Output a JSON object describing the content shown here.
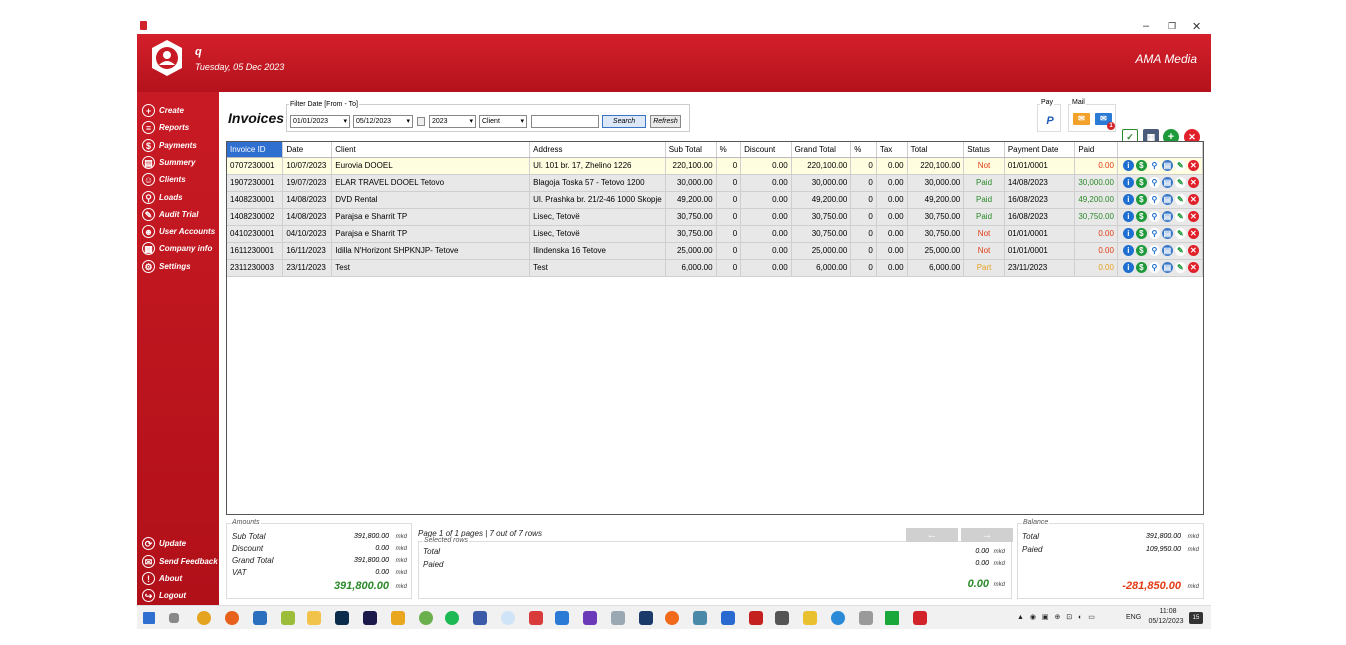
{
  "window": {
    "minimize": "–",
    "maximize": "❐",
    "close": "✕"
  },
  "header": {
    "user_name": "q",
    "date": "Tuesday, 05 Dec 2023",
    "company": "AMA Media"
  },
  "sidebar": {
    "items": [
      {
        "label": "Create",
        "icon": "plus-circle-icon"
      },
      {
        "label": "Reports",
        "icon": "reports-icon"
      },
      {
        "label": "Payments",
        "icon": "payments-icon"
      },
      {
        "label": "Summery",
        "icon": "summary-icon"
      },
      {
        "label": "Clients",
        "icon": "clients-icon"
      },
      {
        "label": "Loads",
        "icon": "loads-icon"
      },
      {
        "label": "Audit Trial",
        "icon": "audit-icon"
      },
      {
        "label": "User Accounts",
        "icon": "user-accounts-icon"
      },
      {
        "label": "Company info",
        "icon": "company-icon"
      },
      {
        "label": "Settings",
        "icon": "gear-icon"
      }
    ],
    "bottom_items": [
      {
        "label": "Update",
        "icon": "update-icon"
      },
      {
        "label": "Send Feedback",
        "icon": "feedback-icon"
      },
      {
        "label": "About",
        "icon": "info-icon"
      },
      {
        "label": "Logout",
        "icon": "logout-icon"
      }
    ]
  },
  "page": {
    "title": "Invoices"
  },
  "filter": {
    "legend": "Filter Date [From - To]",
    "date_from": "01/01/2023",
    "date_to": "05/12/2023",
    "year": "2023",
    "client": "Client",
    "search_value": "",
    "search_label": "Search",
    "refresh_label": "Refresh"
  },
  "toolbar": {
    "pay_label": "Pay",
    "mail_label": "Mail",
    "mail_badge": "1"
  },
  "grid": {
    "columns": [
      "Invoice ID",
      "Date",
      "Client",
      "Address",
      "Sub Total",
      "%",
      "Discount",
      "Grand Total",
      "%",
      "Tax",
      "Total",
      "Status",
      "Payment Date",
      "Paid"
    ],
    "rows": [
      [
        "0707230001",
        "10/07/2023",
        "Eurovia DOOEL",
        "Ul. 101 br. 17, Zhelino 1226",
        "220,100.00",
        "0",
        "0.00",
        "220,100.00",
        "0",
        "0.00",
        "220,100.00",
        "Not",
        "01/01/0001",
        "0.00"
      ],
      [
        "1907230001",
        "19/07/2023",
        "ELAR TRAVEL DOOEL Tetovo",
        "Blagoja Toska 57 - Tetovo 1200",
        "30,000.00",
        "0",
        "0.00",
        "30,000.00",
        "0",
        "0.00",
        "30,000.00",
        "Paid",
        "14/08/2023",
        "30,000.00"
      ],
      [
        "1408230001",
        "14/08/2023",
        "DVD Rental",
        "Ul. Prashka br. 21/2-46 1000 Skopje",
        "49,200.00",
        "0",
        "0.00",
        "49,200.00",
        "0",
        "0.00",
        "49,200.00",
        "Paid",
        "16/08/2023",
        "49,200.00"
      ],
      [
        "1408230002",
        "14/08/2023",
        "Parajsa e Sharrit TP",
        "Lisec, Tetovë",
        "30,750.00",
        "0",
        "0.00",
        "30,750.00",
        "0",
        "0.00",
        "30,750.00",
        "Paid",
        "16/08/2023",
        "30,750.00"
      ],
      [
        "0410230001",
        "04/10/2023",
        "Parajsa e Sharrit TP",
        "Lisec, Tetovë",
        "30,750.00",
        "0",
        "0.00",
        "30,750.00",
        "0",
        "0.00",
        "30,750.00",
        "Not",
        "01/01/0001",
        "0.00"
      ],
      [
        "1611230001",
        "16/11/2023",
        "Idilla N'Horizont SHPKNJP- Tetove",
        "Ilindenska 16 Tetove",
        "25,000.00",
        "0",
        "0.00",
        "25,000.00",
        "0",
        "0.00",
        "25,000.00",
        "Not",
        "01/01/0001",
        "0.00"
      ],
      [
        "2311230003",
        "23/11/2023",
        "Test",
        "Test",
        "6,000.00",
        "0",
        "0.00",
        "6,000.00",
        "0",
        "0.00",
        "6,000.00",
        "Part",
        "23/11/2023",
        "0.00"
      ]
    ]
  },
  "amounts": {
    "legend": "Amounts",
    "sub_total_label": "Sub Total",
    "sub_total": "391,800.00",
    "discount_label": "Discount",
    "discount": "0.00",
    "grand_total_label": "Grand Total",
    "grand_total": "391,800.00",
    "vat_label": "VAT",
    "vat": "0.00",
    "big_total": "391,800.00",
    "unit": "mkd"
  },
  "pager": {
    "info": "Page 1 of 1 pages | 7 out of 7 rows",
    "prev": "←",
    "next": "→",
    "selected_legend": "Selected rows",
    "total_label": "Total",
    "total": "0.00",
    "paid_label": "Paied",
    "paid": "0.00",
    "big_total": "0.00"
  },
  "balance": {
    "legend": "Balance",
    "total_label": "Total",
    "total": "391,800.00",
    "paid_label": "Paied",
    "paid": "109,950.00",
    "big_total": "-281,850.00"
  },
  "taskbar": {
    "lang": "ENG",
    "time": "11:08",
    "date": "05/12/2023",
    "notif_count": "15"
  },
  "colors": {
    "brand_red": "#c81a24",
    "paid_green": "#2a8a2a",
    "not_red": "#e23b14",
    "part_orange": "#e6a020"
  }
}
